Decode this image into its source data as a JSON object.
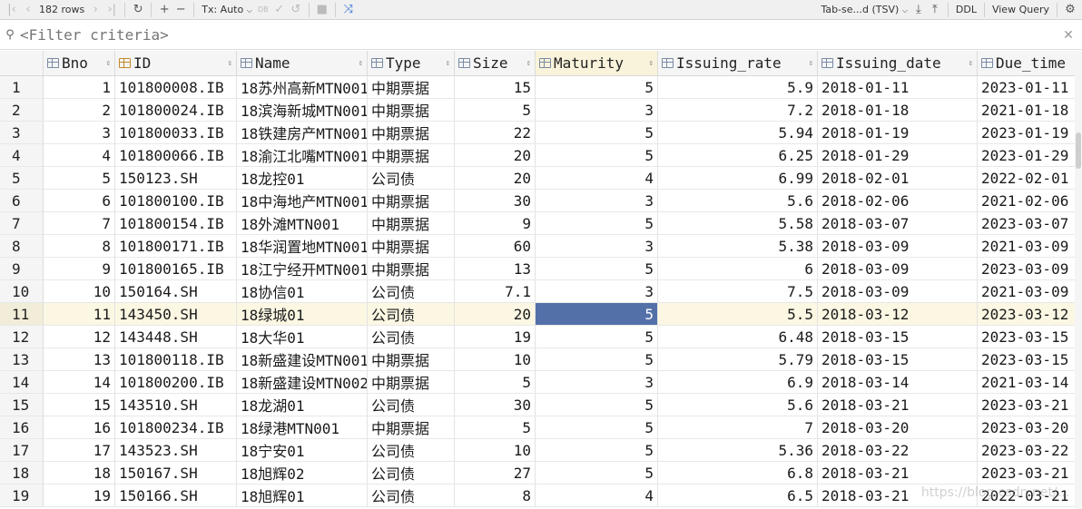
{
  "toolbar": {
    "row_count": "182 rows",
    "tx_mode": "Tx: Auto",
    "export_format": "Tab-se...d (TSV)",
    "ddl_label": "DDL",
    "view_query_label": "View Query"
  },
  "filter": {
    "placeholder": "<Filter criteria>"
  },
  "columns": [
    "Bno",
    "ID",
    "Name",
    "Type",
    "Size",
    "Maturity",
    "Issuing_rate",
    "Issuing_date",
    "Due_time"
  ],
  "rows": [
    [
      "1",
      "1",
      "101800008.IB",
      "18苏州高新MTN001",
      "中期票据",
      "15",
      "5",
      "5.9",
      "2018-01-11",
      "2023-01-11"
    ],
    [
      "2",
      "2",
      "101800024.IB",
      "18滨海新城MTN001",
      "中期票据",
      "5",
      "3",
      "7.2",
      "2018-01-18",
      "2021-01-18"
    ],
    [
      "3",
      "3",
      "101800033.IB",
      "18铁建房产MTN001",
      "中期票据",
      "22",
      "5",
      "5.94",
      "2018-01-19",
      "2023-01-19"
    ],
    [
      "4",
      "4",
      "101800066.IB",
      "18渝江北嘴MTN001",
      "中期票据",
      "20",
      "5",
      "6.25",
      "2018-01-29",
      "2023-01-29"
    ],
    [
      "5",
      "5",
      "150123.SH",
      "18龙控01",
      "公司债",
      "20",
      "4",
      "6.99",
      "2018-02-01",
      "2022-02-01"
    ],
    [
      "6",
      "6",
      "101800100.IB",
      "18中海地产MTN001",
      "中期票据",
      "30",
      "3",
      "5.6",
      "2018-02-06",
      "2021-02-06"
    ],
    [
      "7",
      "7",
      "101800154.IB",
      "18外滩MTN001",
      "中期票据",
      "9",
      "5",
      "5.58",
      "2018-03-07",
      "2023-03-07"
    ],
    [
      "8",
      "8",
      "101800171.IB",
      "18华润置地MTN001",
      "中期票据",
      "60",
      "3",
      "5.38",
      "2018-03-09",
      "2021-03-09"
    ],
    [
      "9",
      "9",
      "101800165.IB",
      "18江宁经开MTN001",
      "中期票据",
      "13",
      "5",
      "6",
      "2018-03-09",
      "2023-03-09"
    ],
    [
      "10",
      "10",
      "150164.SH",
      "18协信01",
      "公司债",
      "7.1",
      "3",
      "7.5",
      "2018-03-09",
      "2021-03-09"
    ],
    [
      "11",
      "11",
      "143450.SH",
      "18绿城01",
      "公司债",
      "20",
      "5",
      "5.5",
      "2018-03-12",
      "2023-03-12"
    ],
    [
      "12",
      "12",
      "143448.SH",
      "18大华01",
      "公司债",
      "19",
      "5",
      "6.48",
      "2018-03-15",
      "2023-03-15"
    ],
    [
      "13",
      "13",
      "101800118.IB",
      "18新盛建设MTN001",
      "中期票据",
      "10",
      "5",
      "5.79",
      "2018-03-15",
      "2023-03-15"
    ],
    [
      "14",
      "14",
      "101800200.IB",
      "18新盛建设MTN002",
      "中期票据",
      "5",
      "3",
      "6.9",
      "2018-03-14",
      "2021-03-14"
    ],
    [
      "15",
      "15",
      "143510.SH",
      "18龙湖01",
      "公司债",
      "30",
      "5",
      "5.6",
      "2018-03-21",
      "2023-03-21"
    ],
    [
      "16",
      "16",
      "101800234.IB",
      "18绿港MTN001",
      "中期票据",
      "5",
      "5",
      "7",
      "2018-03-20",
      "2023-03-20"
    ],
    [
      "17",
      "17",
      "143523.SH",
      "18宁安01",
      "公司债",
      "10",
      "5",
      "5.36",
      "2018-03-22",
      "2023-03-22"
    ],
    [
      "18",
      "18",
      "150167.SH",
      "18旭辉02",
      "公司债",
      "27",
      "5",
      "6.8",
      "2018-03-21",
      "2023-03-21"
    ],
    [
      "19",
      "19",
      "150166.SH",
      "18旭辉01",
      "公司债",
      "8",
      "4",
      "6.5",
      "2018-03-21",
      "2022-03-21"
    ]
  ],
  "selection": {
    "row_index": 10,
    "column": "Maturity"
  },
  "watermark": "https://blog.csdn.net/..."
}
